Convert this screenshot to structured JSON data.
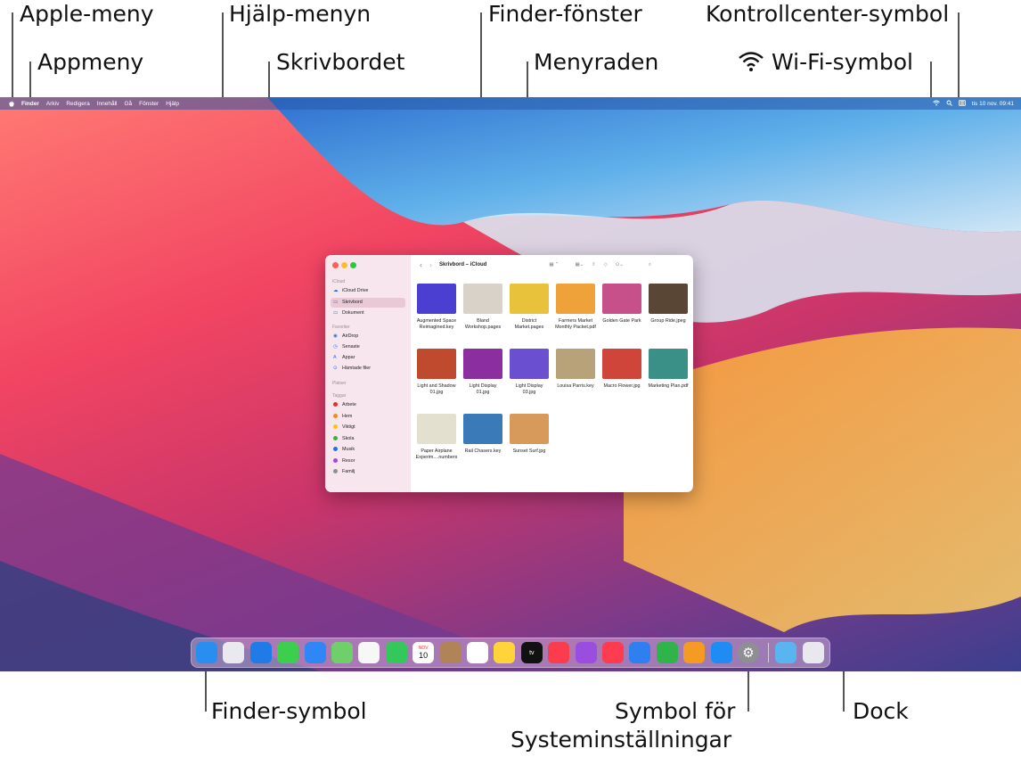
{
  "callouts": {
    "apple_menu": "Apple-meny",
    "app_menu": "Appmeny",
    "help_menu": "Hjälp-menyn",
    "desktop": "Skrivbordet",
    "finder_window": "Finder-fönster",
    "menu_bar": "Menyraden",
    "control_center": "Kontrollcenter-symbol",
    "wifi": "Wi-Fi-symbol",
    "finder_icon": "Finder-symbol",
    "system_settings_line1": "Symbol för",
    "system_settings_line2": "Systeminställningar",
    "dock": "Dock"
  },
  "menubar": {
    "apple": "",
    "items": [
      "Finder",
      "Arkiv",
      "Redigera",
      "Innehåll",
      "Gå",
      "Fönster",
      "Hjälp"
    ],
    "clock": "tis 10 nov. 09:41"
  },
  "finder": {
    "title": "Skrivbord – iCloud",
    "sidebar": {
      "icloud_header": "iCloud",
      "icloud": [
        "iCloud Drive",
        "Skrivbord",
        "Dokument"
      ],
      "favorites_header": "Favoriter",
      "favorites": [
        "AirDrop",
        "Senaste",
        "Appar",
        "Hämtade filer"
      ],
      "places_header": "Platser",
      "tags_header": "Taggar",
      "tags": [
        {
          "name": "Arbete",
          "color": "#e0312f"
        },
        {
          "name": "Hem",
          "color": "#f08a24"
        },
        {
          "name": "Viktigt",
          "color": "#f5c223"
        },
        {
          "name": "Skola",
          "color": "#3cb043"
        },
        {
          "name": "Musik",
          "color": "#2a6fd6"
        },
        {
          "name": "Resor",
          "color": "#a24ad1"
        },
        {
          "name": "Familj",
          "color": "#8e8e93"
        }
      ]
    },
    "files": [
      {
        "name1": "Augmented Space",
        "name2": "Reimagined.key",
        "color": "#4a3fd1"
      },
      {
        "name1": "Bland",
        "name2": "Workshop.pages",
        "color": "#d8d2c8"
      },
      {
        "name1": "District",
        "name2": "Market.pages",
        "color": "#e8c23a"
      },
      {
        "name1": "Farmers Market",
        "name2": "Monthly Packet.pdf",
        "color": "#f0a23a"
      },
      {
        "name1": "Golden Gate Park",
        "name2": "",
        "color": "#c74f8a"
      },
      {
        "name1": "Group Ride.jpeg",
        "name2": "",
        "color": "#5a4634"
      },
      {
        "name1": "Light and Shadow",
        "name2": "01.jpg",
        "color": "#c04a2e"
      },
      {
        "name1": "Light Display",
        "name2": "01.jpg",
        "color": "#8a2ea0"
      },
      {
        "name1": "Light Display",
        "name2": "03.jpg",
        "color": "#6a4fd0"
      },
      {
        "name1": "Louisa Parris.key",
        "name2": "",
        "color": "#b8a27a"
      },
      {
        "name1": "Macro Flower.jpg",
        "name2": "",
        "color": "#d0453a"
      },
      {
        "name1": "Marketing Plan.pdf",
        "name2": "",
        "color": "#3a8f86"
      },
      {
        "name1": "Paper Airplane",
        "name2": "Experim....numbers",
        "color": "#e4e0d0"
      },
      {
        "name1": "Rail Chasers.key",
        "name2": "",
        "color": "#3a7ab8"
      },
      {
        "name1": "Sunset Surf.jpg",
        "name2": "",
        "color": "#d89a5a"
      }
    ]
  },
  "dock": {
    "calendar_month": "NOV",
    "calendar_day": "10",
    "tv_label": "tv",
    "icons": [
      {
        "name": "finder-icon",
        "color": "#2a8ef0"
      },
      {
        "name": "launchpad-icon",
        "color": "#e9e9ef"
      },
      {
        "name": "safari-icon",
        "color": "#1e7be8"
      },
      {
        "name": "messages-icon",
        "color": "#3ccf4e"
      },
      {
        "name": "mail-icon",
        "color": "#2f86f5"
      },
      {
        "name": "maps-icon",
        "color": "#6fcf6a"
      },
      {
        "name": "photos-icon",
        "color": "#f7f7f7"
      },
      {
        "name": "facetime-icon",
        "color": "#34c759"
      },
      {
        "name": "calendar-icon",
        "color": "#ffffff"
      },
      {
        "name": "contacts-icon",
        "color": "#b08456"
      },
      {
        "name": "reminders-icon",
        "color": "#ffffff"
      },
      {
        "name": "notes-icon",
        "color": "#ffd43b"
      },
      {
        "name": "tv-icon",
        "color": "#111111"
      },
      {
        "name": "music-icon",
        "color": "#fa3c4c"
      },
      {
        "name": "podcasts-icon",
        "color": "#9b4de0"
      },
      {
        "name": "news-icon",
        "color": "#ff3b4f"
      },
      {
        "name": "keynote-icon",
        "color": "#2f7ff0"
      },
      {
        "name": "numbers-icon",
        "color": "#2fb44a"
      },
      {
        "name": "pages-icon",
        "color": "#f59a23"
      },
      {
        "name": "app-store-icon",
        "color": "#1f8cf5"
      },
      {
        "name": "system-settings-icon",
        "color": "#8e8e93"
      },
      {
        "name": "downloads-folder-icon",
        "color": "#5ab4f0"
      },
      {
        "name": "trash-icon",
        "color": "#e8e8ee"
      }
    ]
  }
}
